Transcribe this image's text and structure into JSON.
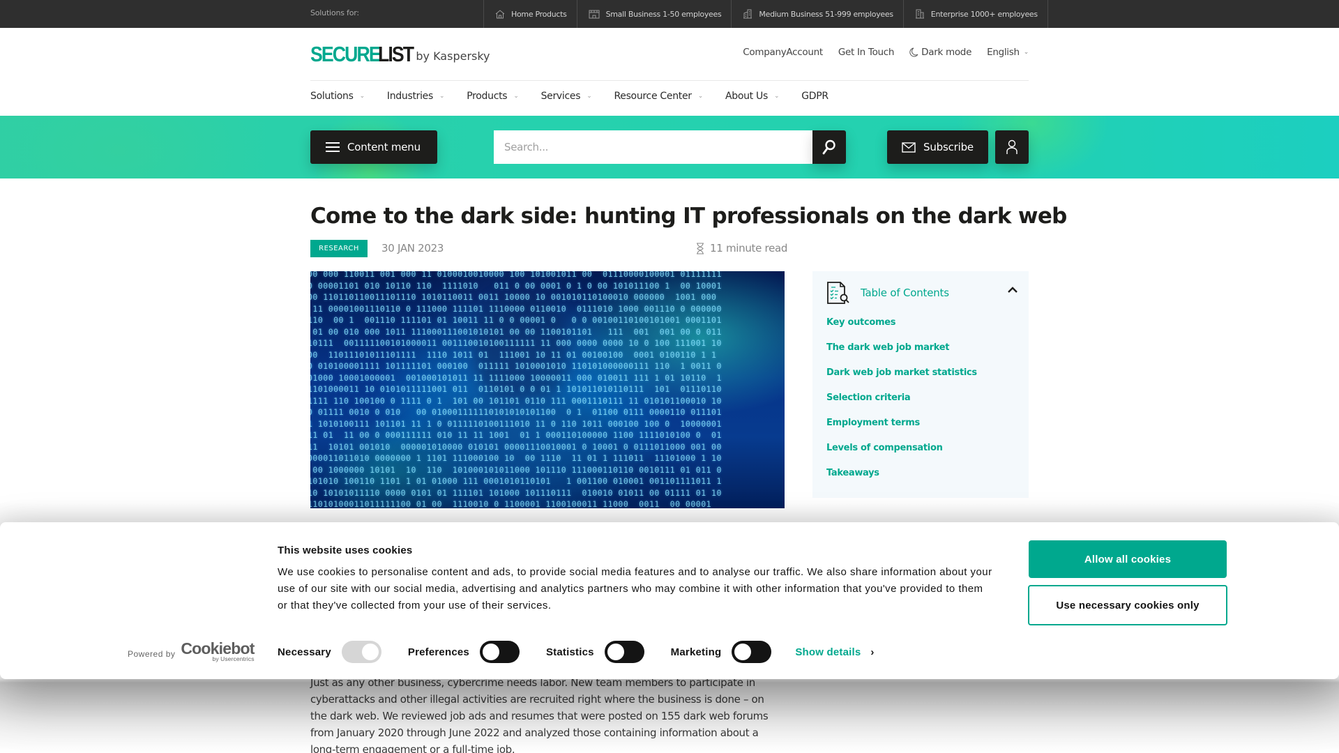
{
  "topbar": {
    "solutions_label": "Solutions for:",
    "segments": [
      {
        "label": "Home Products",
        "icon": "house-icon"
      },
      {
        "label": "Small Business 1-50 employees",
        "icon": "storefront-icon"
      },
      {
        "label": "Medium Business 51-999 employees",
        "icon": "office-building-icon"
      },
      {
        "label": "Enterprise 1000+ employees",
        "icon": "skyscraper-icon"
      }
    ]
  },
  "header": {
    "logo": {
      "part1": "SECURE",
      "part2": "LIST",
      "byline": "by Kaspersky"
    },
    "links": {
      "company_account": "CompanyAccount",
      "get_in_touch": "Get In Touch",
      "dark_mode": "Dark mode",
      "language": "English"
    }
  },
  "nav": {
    "items": [
      {
        "label": "Solutions",
        "dropdown": true
      },
      {
        "label": "Industries",
        "dropdown": true
      },
      {
        "label": "Products",
        "dropdown": true
      },
      {
        "label": "Services",
        "dropdown": true
      },
      {
        "label": "Resource Center",
        "dropdown": true
      },
      {
        "label": "About Us",
        "dropdown": true
      },
      {
        "label": "GDPR",
        "dropdown": false
      }
    ]
  },
  "band": {
    "content_menu_label": "Content menu",
    "search_placeholder": "Search...",
    "search_value": "",
    "subscribe_label": "Subscribe"
  },
  "article": {
    "title": "Come to the dark side: hunting IT professionals on the dark web",
    "tag": "RESEARCH",
    "date": "30 JAN 2023",
    "read_time": "11 minute read",
    "hero_alt": "Binary code with a shadowy figure",
    "body_intro": "Just as any other business, cybercrime needs labor. New team members to participate in cyberattacks and other illegal activities are recruited right where the business is done – on the dark web. We reviewed job ads and resumes that were posted on 155 dark web forums from January 2020 through June 2022 and analyzed those containing information about a long-term engagement or a full-time job."
  },
  "toc": {
    "title": "Table of Contents",
    "expanded": true,
    "items": [
      "Key outcomes",
      "The dark web job market",
      "Dark web job market statistics",
      "Selection criteria",
      "Employment terms",
      "Levels of compensation",
      "Takeaways"
    ]
  },
  "cookie_banner": {
    "title": "This website uses cookies",
    "text": "We use cookies to personalise content and ads, to provide social media features and to analyse our traffic. We also share information about your use of our site with our social media, advertising and analytics partners who may combine it with other information that you've provided to them or that they've collected from your use of their services.",
    "powered_by": "Powered by",
    "brand": "Cookiebot",
    "brand_sub": "by Usercentrics",
    "toggles": [
      {
        "label": "Necessary",
        "state": "on",
        "disabled": true
      },
      {
        "label": "Preferences",
        "state": "off",
        "disabled": false
      },
      {
        "label": "Statistics",
        "state": "off",
        "disabled": false
      },
      {
        "label": "Marketing",
        "state": "off",
        "disabled": false
      }
    ],
    "show_details": "Show details",
    "allow_all": "Allow all cookies",
    "necessary_only": "Use necessary cookies only"
  },
  "colors": {
    "brand_green": "#00a88e",
    "topbar_bg": "#2f2f2f",
    "band_teal": "#23d1b0",
    "dark_button": "#1d1d1b",
    "toc_bg": "#f4f9fc"
  }
}
